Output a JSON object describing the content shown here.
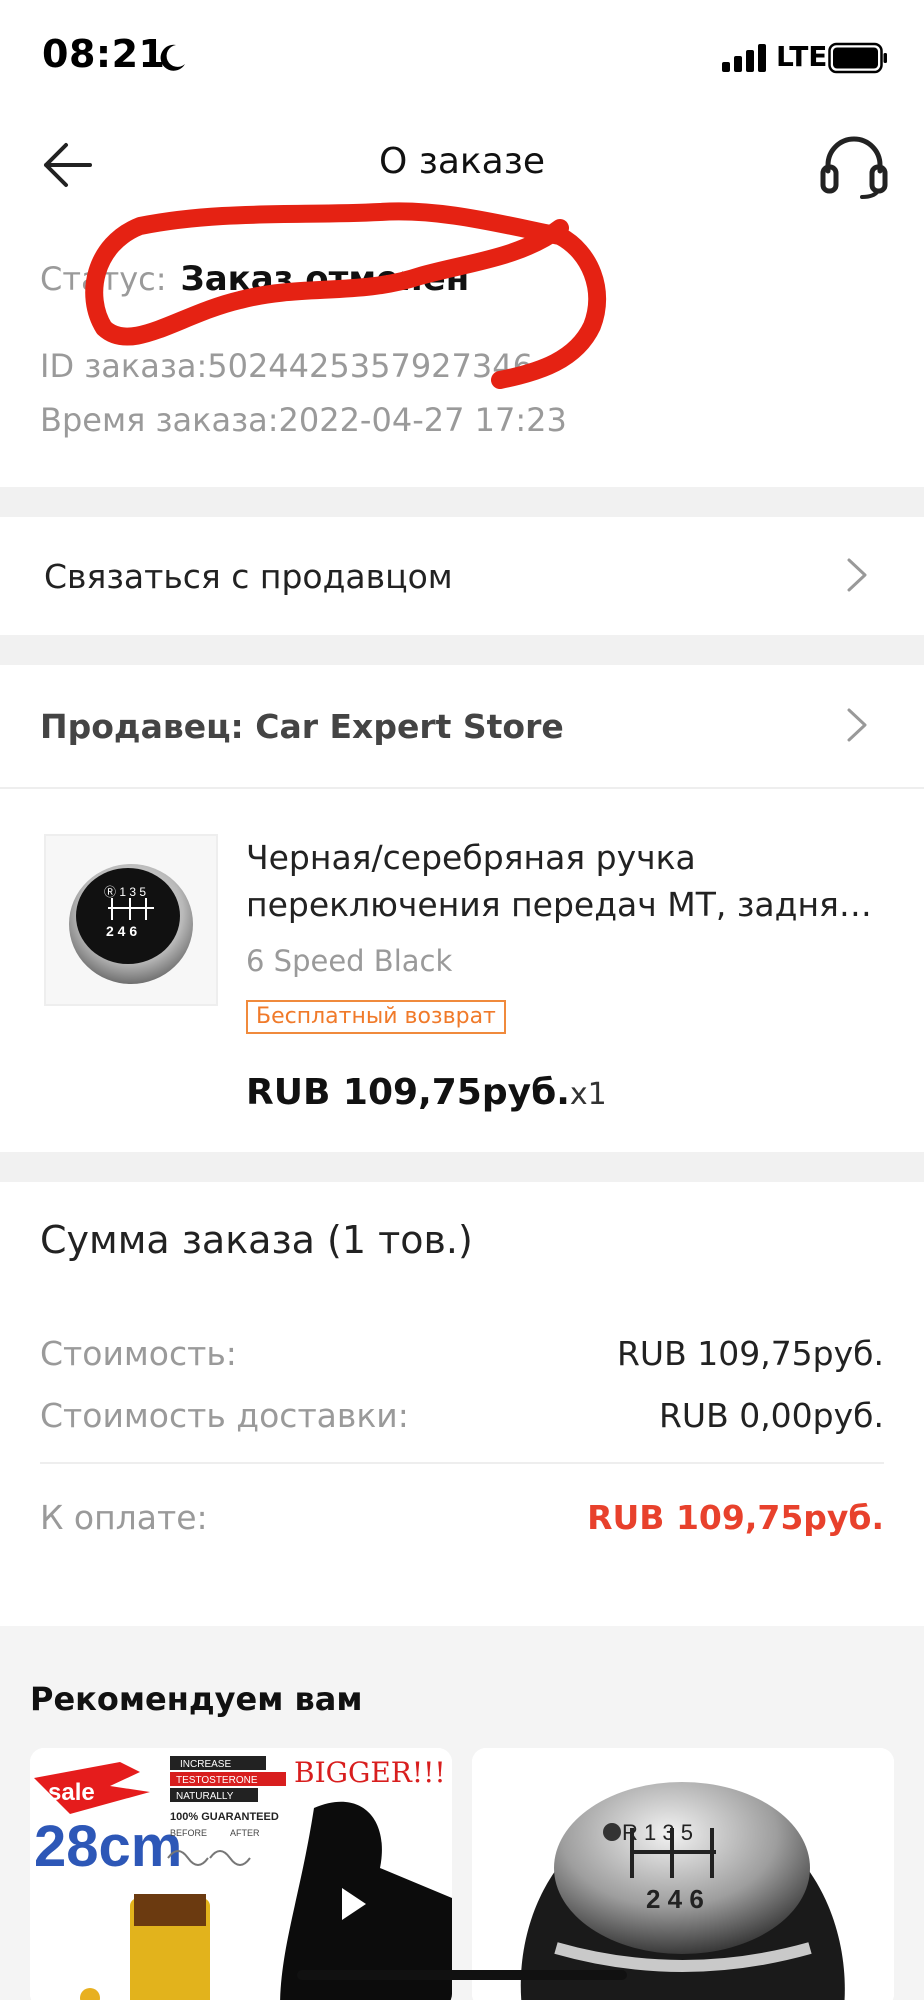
{
  "status_bar": {
    "time": "08:21",
    "network": "LTE"
  },
  "nav": {
    "title": "О заказе"
  },
  "order": {
    "status_label": "Статус:",
    "status_value": "Заказ отменен",
    "id_text": "ID заказа:5024425357927346",
    "time_text": "Время заказа:2022-04-27 17:23"
  },
  "contact_seller": {
    "label": "Связаться с продавцом"
  },
  "seller": {
    "label": "Продавец: Car Expert Store"
  },
  "product": {
    "title_line1": "Черная/серебряная ручка",
    "title_line2": "переключения передач MT, задняя...",
    "variant": "6 Speed Black",
    "badge": "Бесплатный возврат",
    "price": "RUB 109,75руб.",
    "quantity": "x1"
  },
  "summary": {
    "title": "Сумма заказа (1 тов.)",
    "rows": [
      {
        "label": "Стоимость:",
        "value": "RUB 109,75руб."
      },
      {
        "label": "Стоимость доставки:",
        "value": "RUB 0,00руб."
      }
    ],
    "total_label": "К оплате:",
    "total_value": "RUB 109,75руб."
  },
  "recommend": {
    "title": "Рекомендуем вам",
    "card1": {
      "sale": "sale",
      "size": "28cm",
      "bigger": "BIGGER!!!",
      "line1": "INCREASE",
      "line2": "TESTOSTERONE",
      "line3": "NATURALLY",
      "guarantee": "100% GUARANTEED",
      "before": "BEFORE",
      "after": "AFTER"
    },
    "card2": {
      "gear_top": "R 1 3 5",
      "gear_bottom": "2 4 6"
    }
  },
  "colors": {
    "accent_red": "#e8412c",
    "badge_orange": "#f07a2a",
    "scribble_red": "#e52213"
  },
  "icons": [
    "moon-icon",
    "signal-icon",
    "battery-icon",
    "back-arrow-icon",
    "headset-icon",
    "chevron-right-icon"
  ]
}
